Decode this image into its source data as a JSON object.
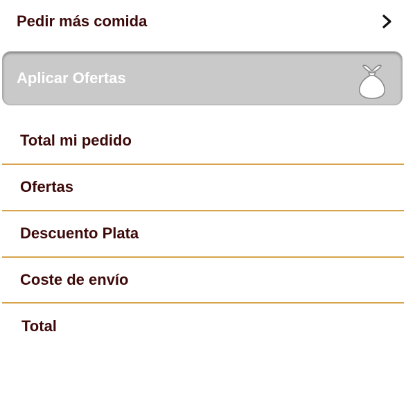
{
  "order_more": {
    "label": "Pedir más comida",
    "chevron_icon": "chevron-right-icon"
  },
  "apply_offers": {
    "label": "Aplicar Ofertas",
    "icon": "bag-icon"
  },
  "summary": {
    "rows": [
      {
        "label": "Total mi pedido"
      },
      {
        "label": "Ofertas"
      },
      {
        "label": "Descuento Plata"
      },
      {
        "label": "Coste de envío"
      },
      {
        "label": "Total"
      }
    ]
  },
  "colors": {
    "text_dark": "#3d0a0a",
    "divider": "#d6a34a",
    "offers_background": "#c9c9c9"
  }
}
